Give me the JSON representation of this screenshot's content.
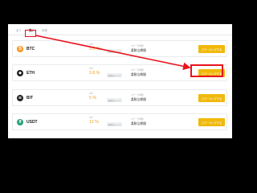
{
  "tabs": [
    {
      "label": "全て",
      "active": false
    },
    {
      "label": "預入",
      "active": true
    },
    {
      "label": "其他",
      "active": false
    }
  ],
  "rows": [
    {
      "coin": "BTC",
      "icon": "bitcoin-icon",
      "icon_color": "#f7931a",
      "glyph": "₿",
      "apy_label": "APY",
      "apy": "3.5 %",
      "tag": "柔軟的ステーク",
      "period_label": "ステーク期間",
      "period": "柔軟な期間",
      "button": "ステーキングする"
    },
    {
      "coin": "ETH",
      "icon": "ethereum-icon",
      "icon_color": "#222222",
      "glyph": "◆",
      "apy_label": "APY",
      "apy": "3.8 %",
      "tag": "柔軟的ステーク",
      "period_label": "ステーク期間",
      "period": "柔軟な期間",
      "button": "ステーキングする"
    },
    {
      "coin": "BIT",
      "icon": "bit-icon",
      "icon_color": "#222222",
      "glyph": "≋",
      "apy_label": "APY",
      "apy": "5 %",
      "tag": "柔軟的ステーク",
      "period_label": "ステーク期間",
      "period": "柔軟な期間",
      "button": "ステーキングする"
    },
    {
      "coin": "USDT",
      "icon": "tether-icon",
      "icon_color": "#26a17b",
      "glyph": "₮",
      "apy_label": "APY",
      "apy": "12 %",
      "tag": "柔軟的ステーク",
      "period_label": "ステーク期間",
      "period": "柔軟な期間",
      "button": "ステーキングする"
    }
  ],
  "colors": {
    "accent": "#f0b90b",
    "apy": "#f0a019",
    "highlight": "#e8141c",
    "background": "#000000"
  }
}
